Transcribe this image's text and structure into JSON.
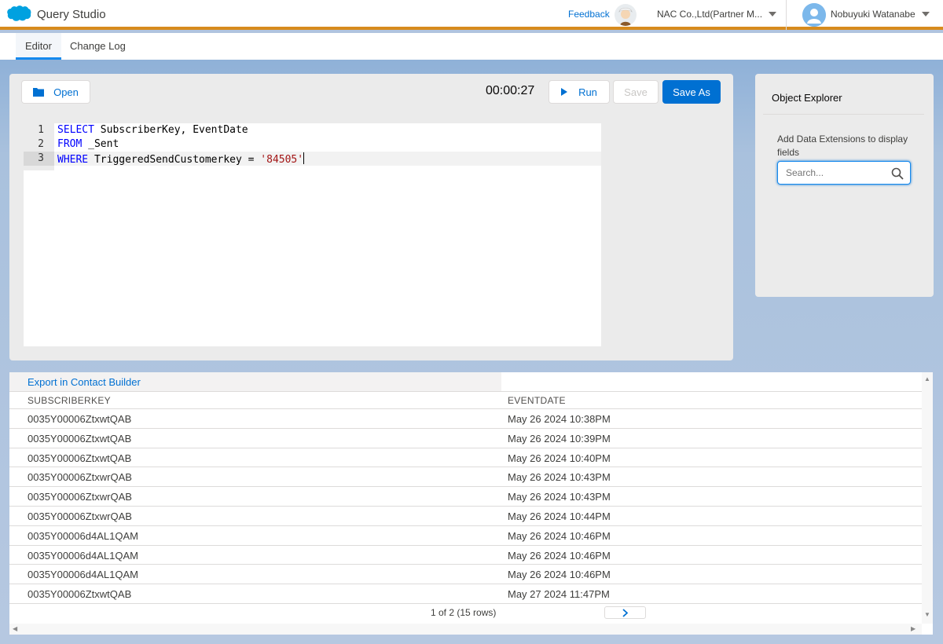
{
  "header": {
    "app_title": "Query Studio",
    "feedback_label": "Feedback",
    "org_name": "NAC Co.,Ltd(Partner M...",
    "user_name": "Nobuyuki Watanabe",
    "brand_color": "#00a1e0",
    "accent_bar_color": "#d78b1d"
  },
  "tabs": [
    {
      "label": "Editor",
      "active": true
    },
    {
      "label": "Change Log",
      "active": false
    }
  ],
  "toolbar": {
    "open_label": "Open",
    "timer": "00:00:27",
    "run_label": "Run",
    "save_label": "Save",
    "save_as_label": "Save As"
  },
  "editor": {
    "lines": [
      {
        "num": "1",
        "keyword": "SELECT",
        "rest": " SubscriberKey, EventDate",
        "string": ""
      },
      {
        "num": "2",
        "keyword": "FROM",
        "rest": " _Sent",
        "string": ""
      },
      {
        "num": "3",
        "keyword": "WHERE",
        "rest": " TriggeredSendCustomerkey = ",
        "string": "'84505'"
      }
    ],
    "active_line": 3
  },
  "explorer": {
    "title": "Object Explorer",
    "hint": "Add Data Extensions to display fields",
    "search_placeholder": "Search..."
  },
  "results": {
    "export_label": "Export in Contact Builder",
    "columns": [
      "SUBSCRIBERKEY",
      "EVENTDATE"
    ],
    "rows": [
      [
        "0035Y00006ZtxwtQAB",
        "May 26 2024 10:38PM"
      ],
      [
        "0035Y00006ZtxwtQAB",
        "May 26 2024 10:39PM"
      ],
      [
        "0035Y00006ZtxwtQAB",
        "May 26 2024 10:40PM"
      ],
      [
        "0035Y00006ZtxwrQAB",
        "May 26 2024 10:43PM"
      ],
      [
        "0035Y00006ZtxwrQAB",
        "May 26 2024 10:43PM"
      ],
      [
        "0035Y00006ZtxwrQAB",
        "May 26 2024 10:44PM"
      ],
      [
        "0035Y00006d4AL1QAM",
        "May 26 2024 10:46PM"
      ],
      [
        "0035Y00006d4AL1QAM",
        "May 26 2024 10:46PM"
      ],
      [
        "0035Y00006d4AL1QAM",
        "May 26 2024 10:46PM"
      ],
      [
        "0035Y00006ZtxwtQAB",
        "May 27 2024 11:47PM"
      ]
    ],
    "pager_text": "1 of 2 (15 rows)"
  }
}
